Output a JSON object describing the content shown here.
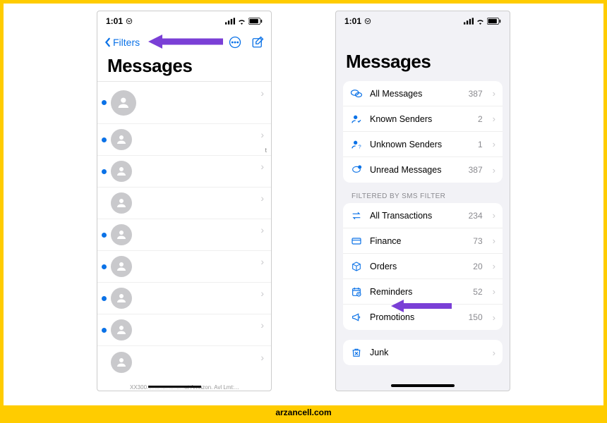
{
  "footer": "arzancell.com",
  "status": {
    "time": "1:01",
    "net_icon": "net-indicator"
  },
  "left": {
    "back_label": "Filters",
    "title": "Messages",
    "snippet_t": "t",
    "bottom_snippet": "XX300........................at Amazon. Avl Lmt:..."
  },
  "right": {
    "title": "Messages",
    "section_label": "FILTERED BY SMS FILTER",
    "groups": [
      {
        "items": [
          {
            "icon": "bubbles",
            "label": "All Messages",
            "count": "387"
          },
          {
            "icon": "person-check",
            "label": "Known Senders",
            "count": "2"
          },
          {
            "icon": "person-question",
            "label": "Unknown Senders",
            "count": "1"
          },
          {
            "icon": "bubble-dot",
            "label": "Unread Messages",
            "count": "387"
          }
        ]
      },
      {
        "items": [
          {
            "icon": "arrows",
            "label": "All Transactions",
            "count": "234"
          },
          {
            "icon": "card",
            "label": "Finance",
            "count": "73"
          },
          {
            "icon": "box",
            "label": "Orders",
            "count": "20"
          },
          {
            "icon": "calendar",
            "label": "Reminders",
            "count": "52"
          },
          {
            "icon": "megaphone",
            "label": "Promotions",
            "count": "150"
          }
        ]
      },
      {
        "items": [
          {
            "icon": "trash",
            "label": "Junk",
            "count": ""
          }
        ]
      }
    ]
  }
}
